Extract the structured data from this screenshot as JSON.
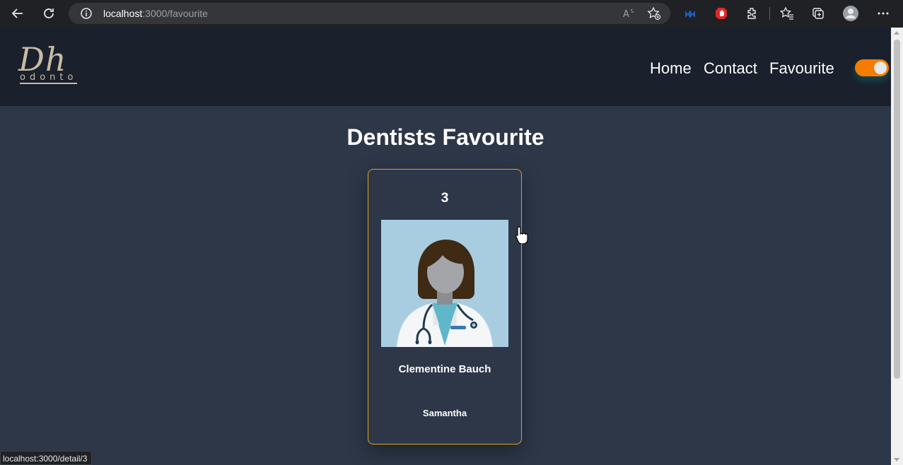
{
  "browser": {
    "url_host": "localhost",
    "url_path": ":3000/favourite",
    "status_url": "localhost:3000/detail/3"
  },
  "header": {
    "logo_main": "Dh",
    "logo_sub": "odonto",
    "menu": [
      {
        "label": "Home"
      },
      {
        "label": "Contact"
      },
      {
        "label": "Favourite"
      }
    ],
    "theme_toggle_on": true
  },
  "main": {
    "title": "Dentists Favourite",
    "cards": [
      {
        "id": "3",
        "name": "Clementine Bauch",
        "username": "Samantha"
      }
    ]
  },
  "colors": {
    "accent_toggle": "#f57c00",
    "card_border": "#e0a21d",
    "page_bg": "#2d3748",
    "header_bg": "#1a202c"
  }
}
